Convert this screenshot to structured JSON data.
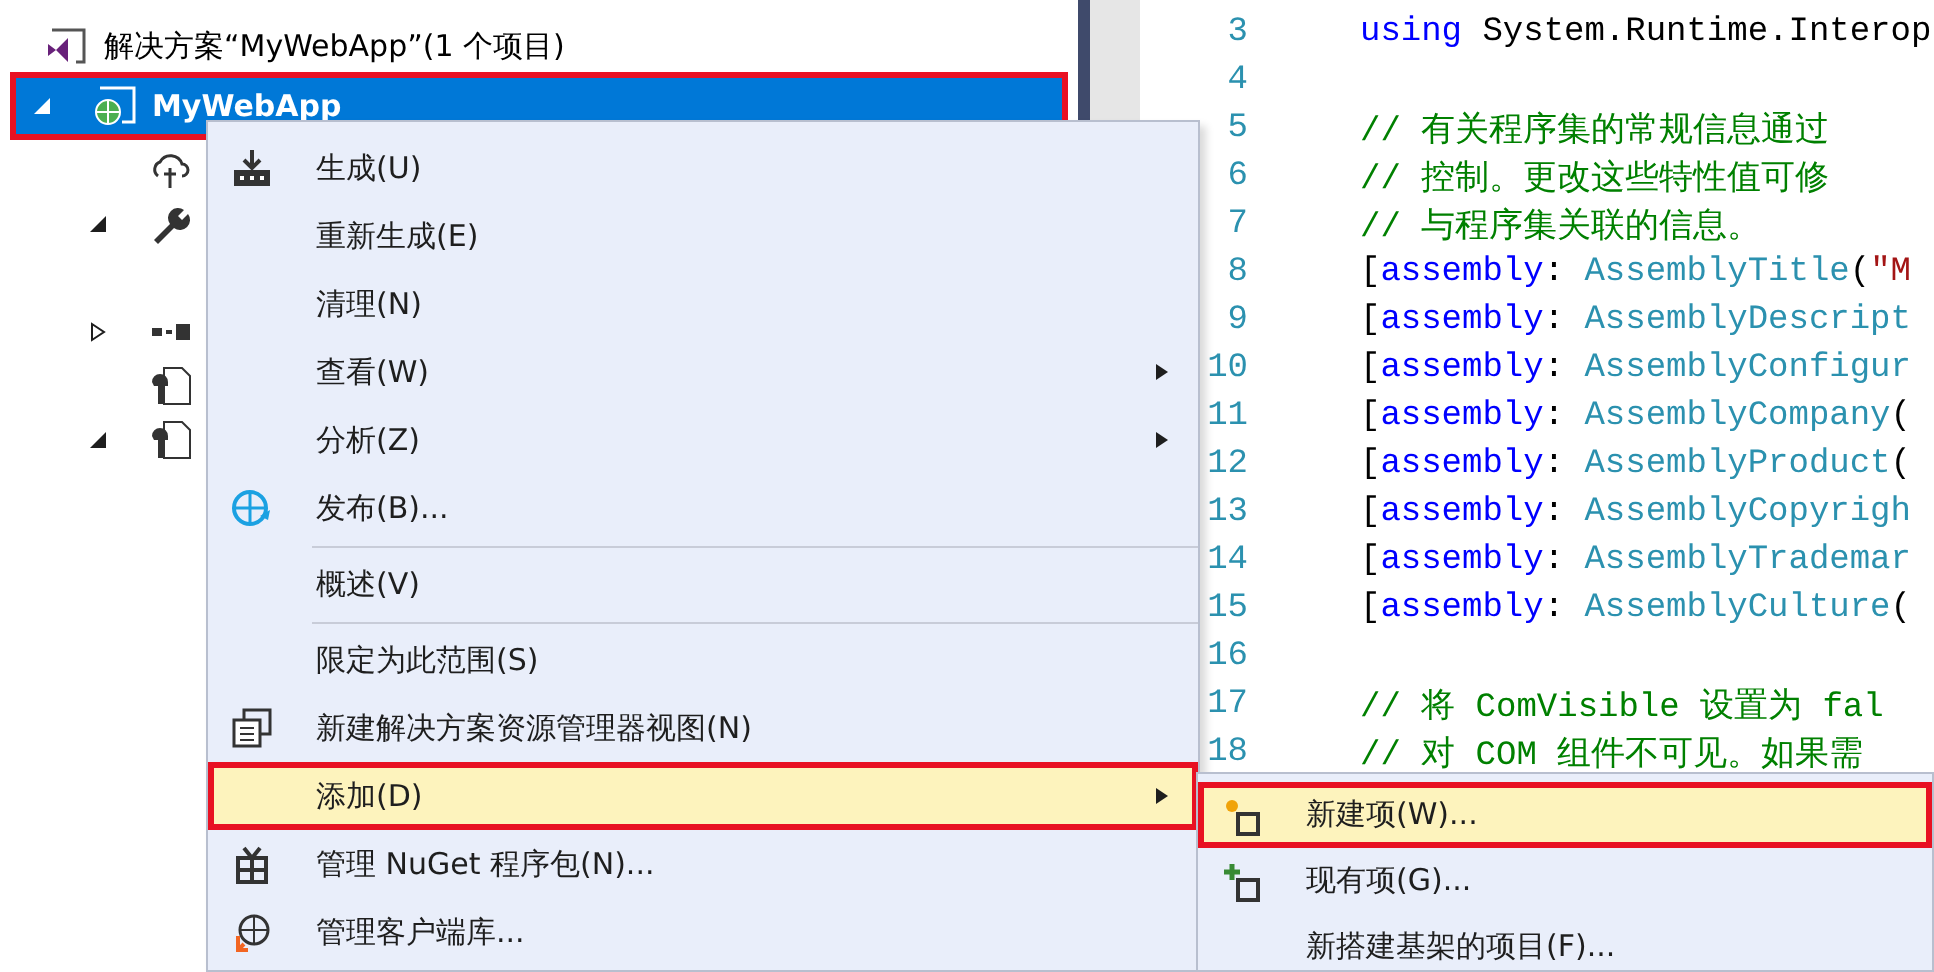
{
  "solution_explorer": {
    "solution": {
      "label": "解决方案“MyWebApp”(1 个项目)"
    },
    "project": {
      "label": "MyWebApp",
      "selected": true,
      "expanded": true,
      "outlined": true,
      "children": [
        {
          "kind": "cloud"
        },
        {
          "kind": "wrench",
          "expanded": true
        },
        {
          "kind": "references",
          "expanded": false
        },
        {
          "kind": "config"
        },
        {
          "kind": "config",
          "expanded": true
        }
      ]
    }
  },
  "context_menu": {
    "items": [
      {
        "kind": "build",
        "label": "生成(U)",
        "submenu": false,
        "highlighted": false
      },
      {
        "kind": "plain",
        "label": "重新生成(E)",
        "submenu": false,
        "highlighted": false
      },
      {
        "kind": "plain",
        "label": "清理(N)",
        "submenu": false,
        "highlighted": false
      },
      {
        "kind": "plain",
        "label": "查看(W)",
        "submenu": true,
        "highlighted": false
      },
      {
        "kind": "plain",
        "label": "分析(Z)",
        "submenu": true,
        "highlighted": false
      },
      {
        "kind": "publish",
        "label": "发布(B)...",
        "submenu": false,
        "highlighted": false
      },
      {
        "kind": "separator"
      },
      {
        "kind": "plain",
        "label": "概述(V)",
        "submenu": false,
        "highlighted": false
      },
      {
        "kind": "separator"
      },
      {
        "kind": "plain",
        "label": "限定为此范围(S)",
        "submenu": false,
        "highlighted": false
      },
      {
        "kind": "windows",
        "label": "新建解决方案资源管理器视图(N)",
        "submenu": false,
        "highlighted": false
      },
      {
        "kind": "plain",
        "label": "添加(D)",
        "submenu": true,
        "highlighted": true,
        "outlined": true
      },
      {
        "kind": "package",
        "label": "管理 NuGet 程序包(N)...",
        "submenu": false,
        "highlighted": false
      },
      {
        "kind": "library",
        "label": "管理客户端库...",
        "submenu": false,
        "highlighted": false
      }
    ]
  },
  "submenu": {
    "items": [
      {
        "kind": "new-item",
        "label": "新建项(W)...",
        "highlighted": true,
        "outlined": true
      },
      {
        "kind": "add-item",
        "label": "现有项(G)...",
        "highlighted": false
      },
      {
        "kind": "plain",
        "label": "新搭建基架的项目(F)...",
        "highlighted": false
      }
    ]
  },
  "editor": {
    "lines": [
      {
        "number": "3",
        "tokens": [
          {
            "kind": "keyword",
            "text": "using"
          },
          {
            "kind": "plain",
            "text": " System.Runtime.Interop"
          }
        ]
      },
      {
        "number": "4"
      },
      {
        "number": "5",
        "tokens": [
          {
            "kind": "comment",
            "text": "// 有关程序集的常规信息通过"
          }
        ]
      },
      {
        "number": "6",
        "tokens": [
          {
            "kind": "comment",
            "text": "// 控制。更改这些特性值可修"
          }
        ]
      },
      {
        "number": "7",
        "tokens": [
          {
            "kind": "comment",
            "text": "// 与程序集关联的信息。"
          }
        ]
      },
      {
        "number": "8",
        "tokens": [
          {
            "kind": "plain",
            "text": "["
          },
          {
            "kind": "keyword",
            "text": "assembly"
          },
          {
            "kind": "plain",
            "text": ": "
          },
          {
            "kind": "type",
            "text": "AssemblyTitle"
          },
          {
            "kind": "plain",
            "text": "("
          },
          {
            "kind": "string",
            "text": "\"M"
          }
        ]
      },
      {
        "number": "9",
        "tokens": [
          {
            "kind": "plain",
            "text": "["
          },
          {
            "kind": "keyword",
            "text": "assembly"
          },
          {
            "kind": "plain",
            "text": ": "
          },
          {
            "kind": "type",
            "text": "AssemblyDescript"
          }
        ]
      },
      {
        "number": "10",
        "tokens": [
          {
            "kind": "plain",
            "text": "["
          },
          {
            "kind": "keyword",
            "text": "assembly"
          },
          {
            "kind": "plain",
            "text": ": "
          },
          {
            "kind": "type",
            "text": "AssemblyConfigur"
          }
        ]
      },
      {
        "number": "11",
        "tokens": [
          {
            "kind": "plain",
            "text": "["
          },
          {
            "kind": "keyword",
            "text": "assembly"
          },
          {
            "kind": "plain",
            "text": ": "
          },
          {
            "kind": "type",
            "text": "AssemblyCompany"
          },
          {
            "kind": "plain",
            "text": "("
          }
        ]
      },
      {
        "number": "12",
        "tokens": [
          {
            "kind": "plain",
            "text": "["
          },
          {
            "kind": "keyword",
            "text": "assembly"
          },
          {
            "kind": "plain",
            "text": ": "
          },
          {
            "kind": "type",
            "text": "AssemblyProduct"
          },
          {
            "kind": "plain",
            "text": "("
          }
        ]
      },
      {
        "number": "13",
        "tokens": [
          {
            "kind": "plain",
            "text": "["
          },
          {
            "kind": "keyword",
            "text": "assembly"
          },
          {
            "kind": "plain",
            "text": ": "
          },
          {
            "kind": "type",
            "text": "AssemblyCopyrigh"
          }
        ]
      },
      {
        "number": "14",
        "tokens": [
          {
            "kind": "plain",
            "text": "["
          },
          {
            "kind": "keyword",
            "text": "assembly"
          },
          {
            "kind": "plain",
            "text": ": "
          },
          {
            "kind": "type",
            "text": "AssemblyTrademar"
          }
        ]
      },
      {
        "number": "15",
        "tokens": [
          {
            "kind": "plain",
            "text": "["
          },
          {
            "kind": "keyword",
            "text": "assembly"
          },
          {
            "kind": "plain",
            "text": ": "
          },
          {
            "kind": "type",
            "text": "AssemblyCulture"
          },
          {
            "kind": "plain",
            "text": "("
          }
        ]
      },
      {
        "number": "16"
      },
      {
        "number": "17",
        "tokens": [
          {
            "kind": "comment",
            "text": "// 将 ComVisible 设置为 fal"
          }
        ]
      },
      {
        "number": "18",
        "tokens": [
          {
            "kind": "comment",
            "text": "// 对 COM 组件不可见。如果需"
          }
        ]
      }
    ]
  }
}
